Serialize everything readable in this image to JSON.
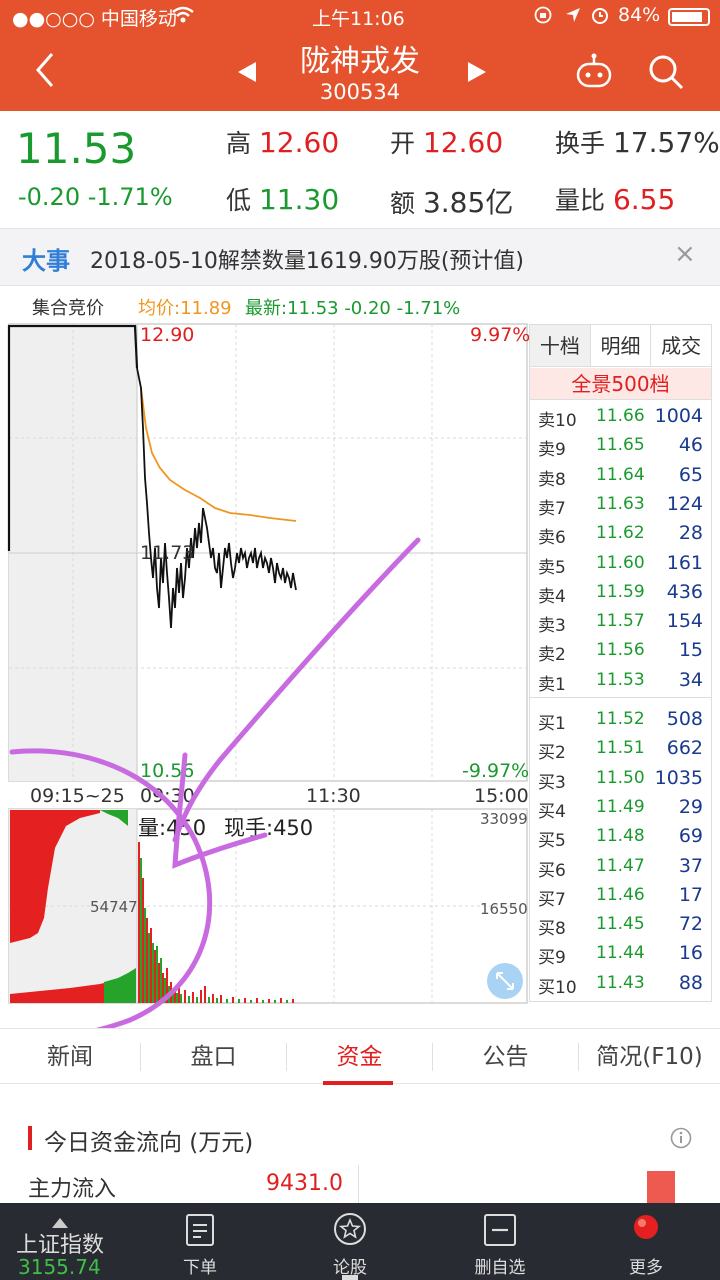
{
  "status_bar": {
    "carrier": "●●○○○ 中国移动",
    "time": "上午11:06",
    "battery": "84%"
  },
  "header": {
    "title": "陇神戎发",
    "code": "300534"
  },
  "quote": {
    "price": "11.53",
    "change": "-0.20 -1.71%",
    "high_label": "高",
    "high": "12.60",
    "low_label": "低",
    "low": "11.30",
    "open_label": "开",
    "open": "12.60",
    "amount_label": "额",
    "amount": "3.85亿",
    "turnover_label": "换手",
    "turnover": "17.57%",
    "volume_ratio_label": "量比",
    "volume_ratio": "6.55"
  },
  "event": {
    "tag": "大事",
    "text": "2018-05-10解禁数量1619.90万股(预计值)",
    "close": "×"
  },
  "chart": {
    "auction_label": "集合竞价",
    "avg_label": "均价:11.89",
    "latest_label": "最新:11.53 -0.20 -1.71%",
    "y_high": "12.90",
    "y_mid": "11.73",
    "y_low": "10.56",
    "pct_high": "9.97%",
    "pct_low": "-9.97%",
    "t_start": "09:15~25",
    "t_open": "09:30",
    "t_mid": "11:30",
    "t_end": "15:00",
    "vol_label": "量:450",
    "hand_label": "现手:450",
    "vol_max": "33099",
    "vol_mid": "16550",
    "auction_vol": "54747",
    "colors": {
      "up": "#e02020",
      "down": "#1a9a2e",
      "avg": "#f0961e",
      "price": "#111111",
      "annotation": "#c86be0"
    }
  },
  "order_book": {
    "tabs": [
      "十档",
      "明细",
      "成交"
    ],
    "full_depth": "全景500档",
    "asks": [
      {
        "name": "卖10",
        "price": "11.66",
        "vol": "1004"
      },
      {
        "name": "卖9",
        "price": "11.65",
        "vol": "46"
      },
      {
        "name": "卖8",
        "price": "11.64",
        "vol": "65"
      },
      {
        "name": "卖7",
        "price": "11.63",
        "vol": "124"
      },
      {
        "name": "卖6",
        "price": "11.62",
        "vol": "28"
      },
      {
        "name": "卖5",
        "price": "11.60",
        "vol": "161"
      },
      {
        "name": "卖4",
        "price": "11.59",
        "vol": "436"
      },
      {
        "name": "卖3",
        "price": "11.57",
        "vol": "154"
      },
      {
        "name": "卖2",
        "price": "11.56",
        "vol": "15"
      },
      {
        "name": "卖1",
        "price": "11.53",
        "vol": "34"
      }
    ],
    "bids": [
      {
        "name": "买1",
        "price": "11.52",
        "vol": "508"
      },
      {
        "name": "买2",
        "price": "11.51",
        "vol": "662"
      },
      {
        "name": "买3",
        "price": "11.50",
        "vol": "1035"
      },
      {
        "name": "买4",
        "price": "11.49",
        "vol": "29"
      },
      {
        "name": "买5",
        "price": "11.48",
        "vol": "69"
      },
      {
        "name": "买6",
        "price": "11.47",
        "vol": "37"
      },
      {
        "name": "买7",
        "price": "11.46",
        "vol": "17"
      },
      {
        "name": "买8",
        "price": "11.45",
        "vol": "72"
      },
      {
        "name": "买9",
        "price": "11.44",
        "vol": "16"
      },
      {
        "name": "买10",
        "price": "11.43",
        "vol": "88"
      }
    ]
  },
  "tabs": [
    "新闻",
    "盘口",
    "资金",
    "公告",
    "简况(F10)"
  ],
  "capital": {
    "title": "今日资金流向 (万元)",
    "inflow_label": "主力流入",
    "inflow_value": "9431.0"
  },
  "footer": {
    "index_name": "上证指数",
    "index_value": "3155.74",
    "items": [
      "下单",
      "论股",
      "删自选",
      "更多"
    ]
  }
}
